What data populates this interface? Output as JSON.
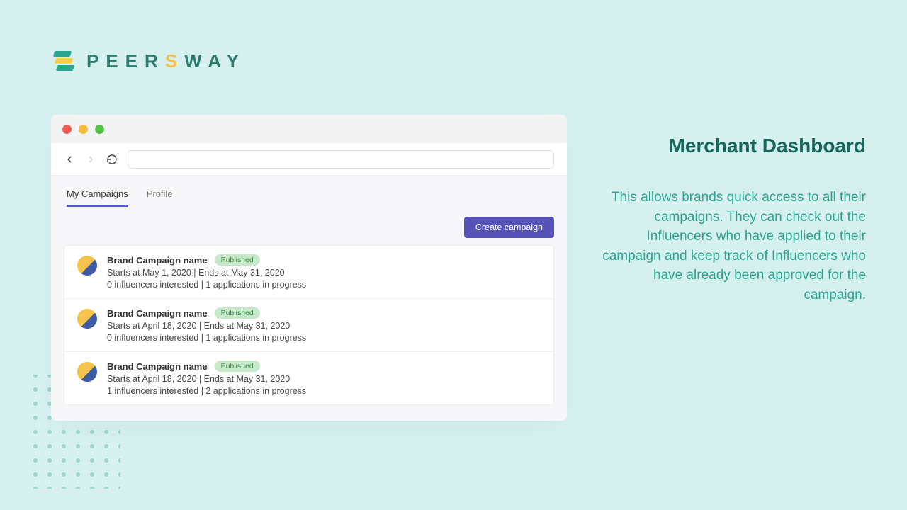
{
  "brand": {
    "name_1": "PEER",
    "name_2": "S",
    "name_3": "WAY"
  },
  "headline": "Merchant Dashboard",
  "description": "This allows brands quick access to all their campaigns. They can check out the Influencers who have applied to their campaign and keep track of Influencers who have already been approved for the campaign.",
  "app": {
    "tabs": {
      "campaigns": "My Campaigns",
      "profile": "Profile"
    },
    "create_button": "Create campaign",
    "rows": [
      {
        "name": "Brand Campaign name",
        "status": "Published",
        "dates": "Starts at May 1, 2020 | Ends at May 31, 2020",
        "stats": "0 influencers interested | 1 applications in progress"
      },
      {
        "name": "Brand Campaign name",
        "status": "Published",
        "dates": "Starts at April 18, 2020 | Ends at May 31, 2020",
        "stats": "0 influencers interested | 1 applications in progress"
      },
      {
        "name": "Brand Campaign name",
        "status": "Published",
        "dates": "Starts at April 18, 2020 | Ends at May 31, 2020",
        "stats": "1 influencers interested | 2 applications in progress"
      }
    ]
  }
}
